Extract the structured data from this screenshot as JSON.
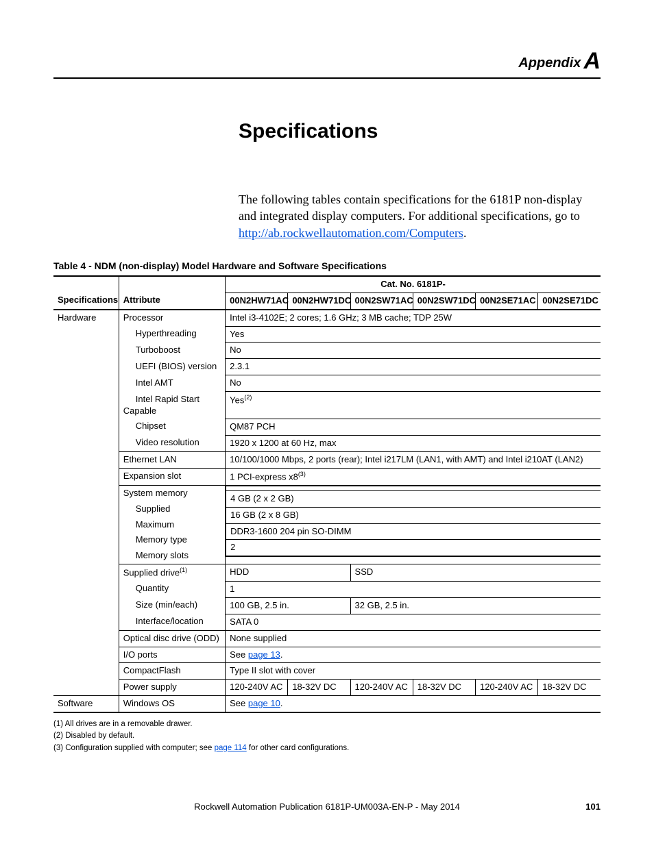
{
  "appendix": {
    "label": "Appendix",
    "letter": "A"
  },
  "title": "Specifications",
  "intro": {
    "preText": "The following tables contain specifications for the 6181P non-display and integrated display computers. For additional specifications, go to ",
    "linkText": "http://ab.rockwellautomation.com/Computers",
    "postText": "."
  },
  "tableTitle": "Table 4 - NDM (non-display) Model Hardware and Software Specifications",
  "header": {
    "catNoPrefix": "Cat. No. 6181P-",
    "specCol": "Specifications",
    "attrCol": "Attribute",
    "models": [
      "00N2HW71AC",
      "00N2HW71DC",
      "00N2SW71AC",
      "00N2SW71DC",
      "00N2SE71AC",
      "00N2SE71DC"
    ]
  },
  "groups": {
    "hardware": "Hardware",
    "software": "Software"
  },
  "rows": {
    "processor": {
      "attr": "Processor",
      "val": "Intel i3-4102E; 2 cores; 1.6 GHz; 3 MB cache; TDP 25W"
    },
    "hyper": {
      "attr": "Hyperthreading",
      "val": "Yes"
    },
    "turbo": {
      "attr": "Turboboost",
      "val": "No"
    },
    "uefi": {
      "attr": "UEFI (BIOS) version",
      "val": "2.3.1"
    },
    "amt": {
      "attr": "Intel AMT",
      "val": "No"
    },
    "rapidstart": {
      "attr": "Intel Rapid Start Capable",
      "val": "Yes",
      "note": "(2)"
    },
    "chipset": {
      "attr": "Chipset",
      "val": "QM87 PCH"
    },
    "video": {
      "attr": "Video resolution",
      "val": "1920 x 1200 at 60 Hz, max"
    },
    "lan": {
      "attr": "Ethernet LAN",
      "val": "10/100/1000 Mbps, 2 ports (rear); Intel i217LM (LAN1, with AMT) and Intel i210AT (LAN2)"
    },
    "expslot": {
      "attr": "Expansion slot",
      "val": "1 PCI-express x8",
      "note": "(3)"
    },
    "sysmem": {
      "attr": "System memory"
    },
    "memsupplied": {
      "attr": "Supplied",
      "val": "4 GB (2 x 2 GB)"
    },
    "memmax": {
      "attr": "Maximum",
      "val": "16 GB (2 x 8 GB)"
    },
    "memtype": {
      "attr": "Memory type",
      "val": "DDR3-1600 204 pin SO-DIMM"
    },
    "memslots": {
      "attr": "Memory slots",
      "val": "2"
    },
    "supdrive": {
      "attr": "Supplied drive",
      "note": "(1)",
      "valA": "HDD",
      "valB": "SSD"
    },
    "driveqty": {
      "attr": "Quantity",
      "val": "1"
    },
    "drivesize": {
      "attr": "Size (min/each)",
      "valA": "100 GB, 2.5 in.",
      "valB": "32 GB, 2.5 in."
    },
    "driveif": {
      "attr": "Interface/location",
      "val": "SATA 0"
    },
    "odd": {
      "attr": "Optical disc drive (ODD)",
      "val": "None supplied"
    },
    "ioports": {
      "attr": "I/O ports",
      "pre": "See ",
      "link": "page 13",
      "post": "."
    },
    "cf": {
      "attr": "CompactFlash",
      "val": "Type II slot with cover"
    },
    "psu": {
      "attr": "Power supply",
      "vals": [
        "120-240V AC",
        "18-32V DC",
        "120-240V AC",
        "18-32V DC",
        "120-240V AC",
        "18-32V DC"
      ]
    },
    "winos": {
      "attr": "Windows OS",
      "pre": "See ",
      "link": "page 10",
      "post": "."
    }
  },
  "footnotes": {
    "f1": "(1)   All drives are in a removable drawer.",
    "f2": "(2)   Disabled by default.",
    "f3pre": "(3)   Configuration supplied with computer; see ",
    "f3link": "page 114",
    "f3post": " for other card configurations."
  },
  "footer": "Rockwell Automation Publication 6181P-UM003A-EN-P - May 2014",
  "pageNumber": "101"
}
